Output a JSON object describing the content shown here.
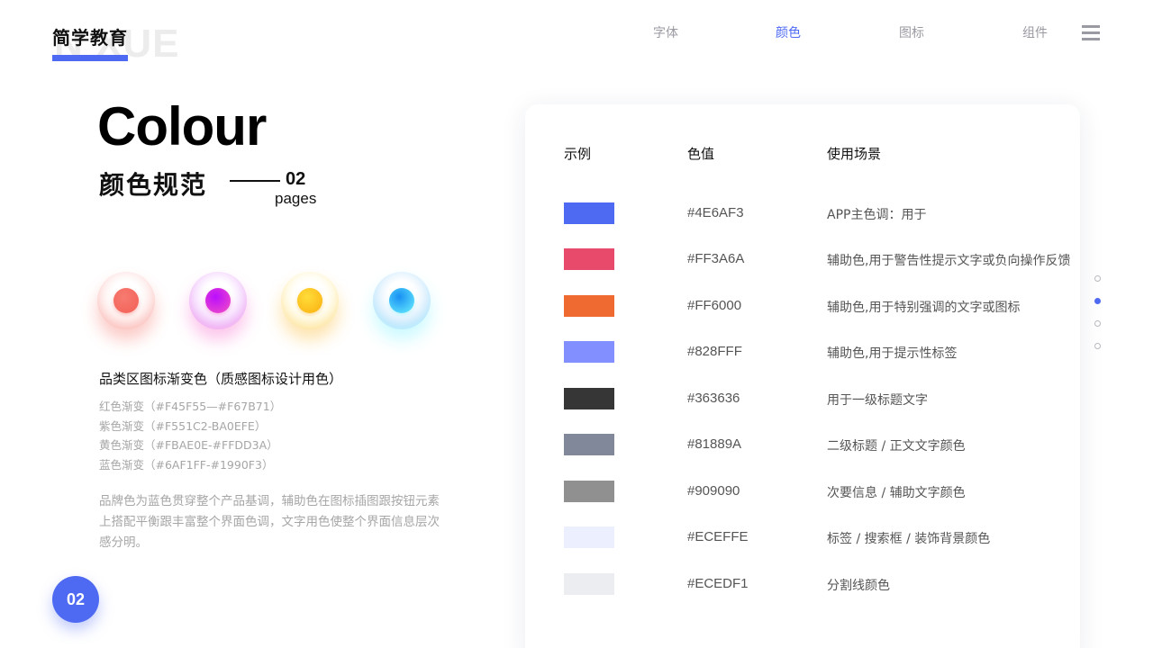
{
  "brand": {
    "name": "简学教育",
    "watermark": "N XUE"
  },
  "nav": {
    "items": [
      "字体",
      "颜色",
      "图标",
      "组件"
    ],
    "active_index": 1
  },
  "heading": {
    "title_en": "Colour",
    "title_cn": "颜色规范",
    "page_number": "02",
    "page_word": "pages"
  },
  "category_icons": {
    "orbs": [
      {
        "name": "red",
        "from": "#F45F55",
        "to": "#F67B71"
      },
      {
        "name": "purple",
        "from": "#F551C2",
        "to": "#BA0EFE"
      },
      {
        "name": "yellow",
        "from": "#FBAE0E",
        "to": "#FFDD3A"
      },
      {
        "name": "blue",
        "from": "#6AF1FF",
        "to": "#1990F3"
      }
    ],
    "title": "品类区图标渐变色（质感图标设计用色）",
    "gradients": [
      "红色渐变（#F45F55—#F67B71）",
      "紫色渐变（#F551C2-BA0EFE）",
      "黄色渐变（#FBAE0E-#FFDD3A）",
      "蓝色渐变（#6AF1FF-#1990F3）"
    ]
  },
  "description": "品牌色为蓝色贯穿整个产品基调，辅助色在图标插图跟按钮元素上搭配平衡跟丰富整个界面色调，文字用色使整个界面信息层次感分明。",
  "badge": "02",
  "table": {
    "headers": {
      "example": "示例",
      "value": "色值",
      "usage": "使用场景"
    },
    "rows": [
      {
        "swatch": "#4E6AF3",
        "hex": "#4E6AF3",
        "usage": "APP主色调：用于"
      },
      {
        "swatch": "#E84A6C",
        "hex": "#FF3A6A",
        "usage": "辅助色,用于警告性提示文字或负向操作反馈"
      },
      {
        "swatch": "#EF6A30",
        "hex": "#FF6000",
        "usage": "辅助色,用于特别强调的文字或图标"
      },
      {
        "swatch": "#828FFF",
        "hex": "#828FFF",
        "usage": "辅助色,用于提示性标签"
      },
      {
        "swatch": "#363636",
        "hex": "#363636",
        "usage": "用于一级标题文字"
      },
      {
        "swatch": "#81889A",
        "hex": "#81889A",
        "usage": "二级标题 / 正文文字颜色"
      },
      {
        "swatch": "#909090",
        "hex": "#909090",
        "usage": "次要信息 / 辅助文字颜色"
      },
      {
        "swatch": "#ECEFFE",
        "hex": "#ECEFFE",
        "usage": "标签 / 搜索框 / 装饰背景颜色"
      },
      {
        "swatch": "#ECEDF1",
        "hex": "#ECEDF1",
        "usage": "分割线颜色"
      }
    ]
  },
  "pager": {
    "count": 4,
    "active_index": 1
  },
  "colors": {
    "brand": "#4E6AF3",
    "nav_inactive": "#9A9AA2",
    "muted_text": "#A6A6A6"
  }
}
